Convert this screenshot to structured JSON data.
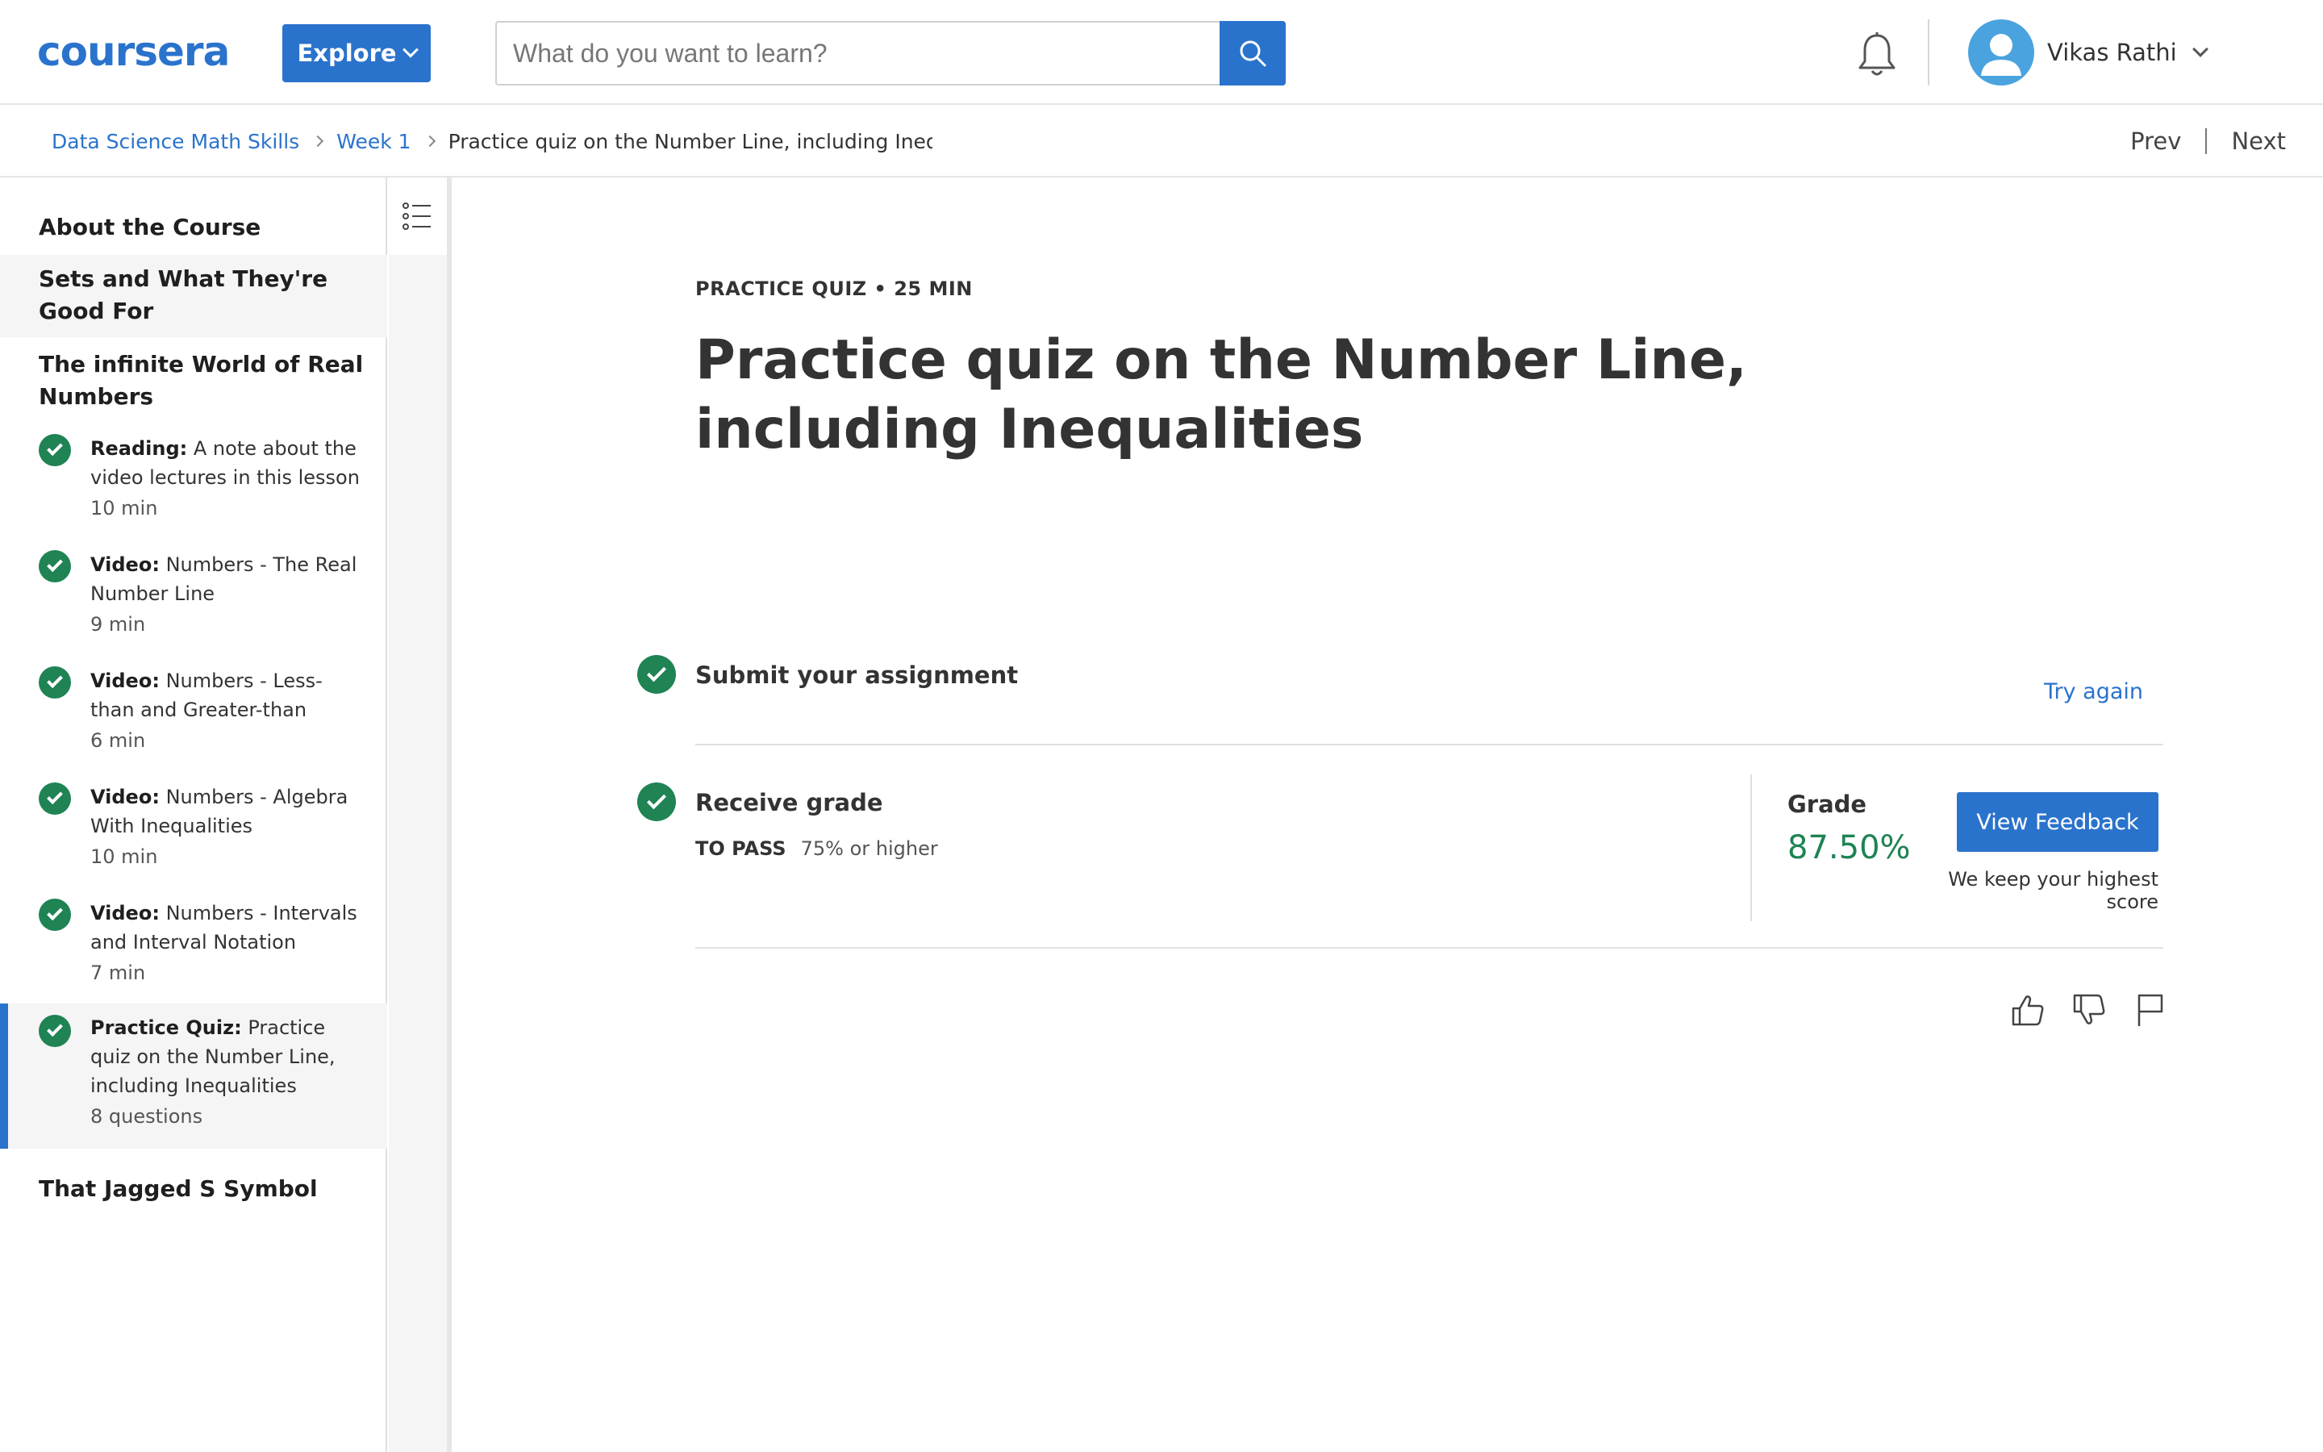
{
  "header": {
    "logo_text": "coursera",
    "explore_label": "Explore",
    "search_placeholder": "What do you want to learn?",
    "user_name": "Vikas Rathi"
  },
  "breadcrumb": {
    "course": "Data Science Math Skills",
    "week": "Week 1",
    "current": "Practice quiz on the Number Line, including Inequalities",
    "prev": "Prev",
    "next": "Next"
  },
  "sidebar": {
    "sections": [
      "About the Course",
      "Sets and What They're Good For",
      "The infinite World of Real Numbers",
      "That Jagged S Symbol"
    ],
    "items": [
      {
        "kind": "Reading:",
        "title": "A note about the video lectures in this lesson",
        "meta": "10 min"
      },
      {
        "kind": "Video:",
        "title": "Numbers - The Real Number Line",
        "meta": "9 min"
      },
      {
        "kind": "Video:",
        "title": "Numbers - Less-than and Greater-than",
        "meta": "6 min"
      },
      {
        "kind": "Video:",
        "title": "Numbers - Algebra With Inequalities",
        "meta": "10 min"
      },
      {
        "kind": "Video:",
        "title": "Numbers - Intervals and Interval Notation",
        "meta": "7 min"
      },
      {
        "kind": "Practice Quiz:",
        "title": "Practice quiz on the Number Line, including Inequalities",
        "meta": "8 questions"
      }
    ]
  },
  "main": {
    "label": "PRACTICE QUIZ • 25 MIN",
    "title": "Practice quiz on the Number Line, including Inequalities",
    "submit_title": "Submit your assignment",
    "try_again": "Try again",
    "receive_title": "Receive grade",
    "to_pass_label": "TO PASS",
    "to_pass_value": "75% or higher",
    "grade_label": "Grade",
    "grade_value": "87.50%",
    "view_feedback": "View Feedback",
    "keep_note": "We keep your highest score"
  },
  "colors": {
    "brand": "#2a73cc",
    "success": "#1f8354"
  }
}
